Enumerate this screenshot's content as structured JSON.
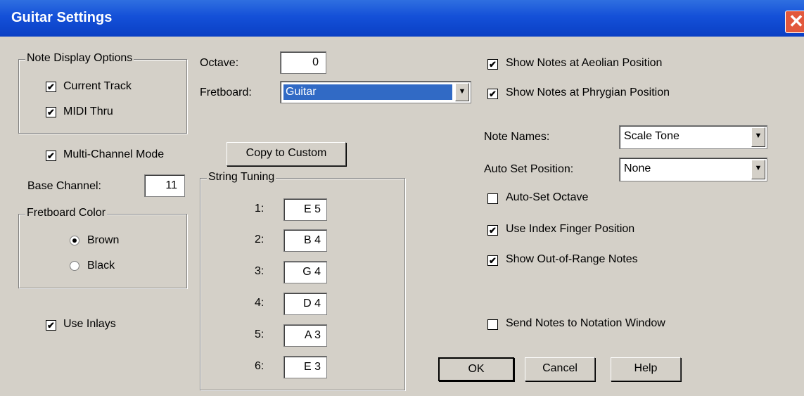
{
  "window": {
    "title": "Guitar Settings",
    "close_glyph": "✕"
  },
  "note_display": {
    "legend": "Note Display Options",
    "current_track": {
      "label": "Current Track",
      "checked": true
    },
    "midi_thru": {
      "label": "MIDI Thru",
      "checked": true
    }
  },
  "multi_channel": {
    "label": "Multi-Channel Mode",
    "checked": true
  },
  "base_channel": {
    "label": "Base Channel:",
    "value": "11"
  },
  "fretboard_color": {
    "legend": "Fretboard Color",
    "options": [
      "Brown",
      "Black"
    ],
    "selected": "Brown"
  },
  "use_inlays": {
    "label": "Use Inlays",
    "checked": true
  },
  "octave": {
    "label": "Octave:",
    "value": "0"
  },
  "fretboard": {
    "label": "Fretboard:",
    "value": "Guitar"
  },
  "copy_to_custom": "Copy to Custom",
  "string_tuning": {
    "legend": "String Tuning",
    "strings": [
      {
        "label": "1:",
        "value": "E 5"
      },
      {
        "label": "2:",
        "value": "B 4"
      },
      {
        "label": "3:",
        "value": "G 4"
      },
      {
        "label": "4:",
        "value": "D 4"
      },
      {
        "label": "5:",
        "value": "A 3"
      },
      {
        "label": "6:",
        "value": "E 3"
      }
    ]
  },
  "show_aeolian": {
    "label": "Show Notes at Aeolian Position",
    "checked": true
  },
  "show_phrygian": {
    "label": "Show Notes at Phrygian Position",
    "checked": true
  },
  "note_names": {
    "label": "Note Names:",
    "value": "Scale Tone"
  },
  "auto_set_position": {
    "label": "Auto Set Position:",
    "value": "None"
  },
  "auto_set_octave": {
    "label": "Auto-Set Octave",
    "checked": false
  },
  "use_index_finger": {
    "label": "Use Index Finger Position",
    "checked": true
  },
  "show_out_of_range": {
    "label": "Show Out-of-Range Notes",
    "checked": true
  },
  "send_notes_notation": {
    "label": "Send Notes to Notation Window",
    "checked": false
  },
  "buttons": {
    "ok": "OK",
    "cancel": "Cancel",
    "help": "Help"
  },
  "colors": {
    "titlebar": "#0a3fc4",
    "face": "#d4d0c8",
    "selection": "#316ac5"
  }
}
